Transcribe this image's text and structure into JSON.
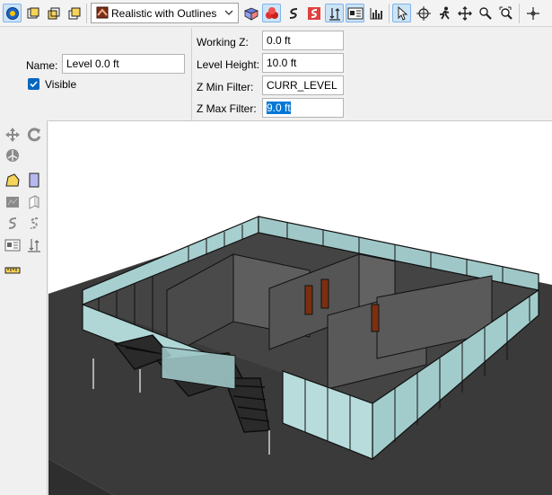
{
  "toolbar": {
    "render_mode": "Realistic with Outlines",
    "left_icons": [
      "3d-view-icon",
      "top-view-icon",
      "front-view-icon",
      "side-view-icon"
    ],
    "mid_icons": [
      "cube-icon",
      "shapes-icon",
      "stairs-icon",
      "stairs-red-icon",
      "level-icon",
      "image-icon",
      "chart-icon"
    ],
    "right_icons": [
      "select-arrow-icon",
      "pan-icon",
      "walk-icon",
      "move-icon",
      "zoom-icon",
      "zoom-extents-icon",
      "crosshair-icon"
    ]
  },
  "level": {
    "name_label": "Name:",
    "name_value": "Level 0.0 ft",
    "visible_label": "Visible",
    "visible_checked": true
  },
  "fields": {
    "working_z_label": "Working Z:",
    "working_z_value": "0.0 ft",
    "level_height_label": "Level Height:",
    "level_height_value": "10.0 ft",
    "z_min_label": "Z Min Filter:",
    "z_min_value": "CURR_LEVEL",
    "z_max_label": "Z Max Filter:",
    "z_max_value": "9.0 ft"
  },
  "palette_icons": [
    "pan-tool-icon",
    "rotate-tool-icon",
    "orbit-tool-icon",
    "polygon-icon",
    "rectangle-icon",
    "slab-icon",
    "wall-icon",
    "stair-icon",
    "stair-alt-icon",
    "image-tool-icon",
    "level-tool-icon",
    "ruler-icon"
  ],
  "colors": {
    "accent": "#0078d7",
    "glass": "#a8cfcf",
    "wall": "#5a5a5a",
    "ground": "#3a3a3a"
  }
}
